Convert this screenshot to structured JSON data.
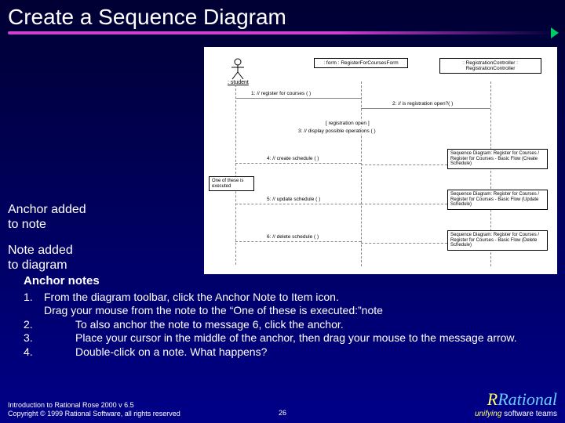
{
  "title": "Create a  Sequence Diagram",
  "annotations": {
    "anchor_added": "Anchor added\nto note",
    "note_added": "Note added\nto diagram"
  },
  "diagram": {
    "actor_label": ": student",
    "lifeline_form": ": form : RegisterForCoursesForm",
    "lifeline_controller": ": RegistrationController : RegistrationController",
    "msg1": "1: // register for courses ( )",
    "msg2": "2: // is registration open?( )",
    "guard": "[ registration open ]",
    "msg3": "3: // display possible operations ( )",
    "msg4": "4: // create schedule ( )",
    "msg5": "5: // update schedule ( )",
    "msg6": "6: // delete schedule ( )",
    "note_one_exec": "One of these is executed",
    "note_ref_create": "Sequence Diagram: Register for Courses / Register for Courses - Basic Flow (Create Schedule)",
    "note_ref_update": "Sequence Diagram: Register for Courses / Register for Courses - Basic Flow (Update Schedule)",
    "note_ref_delete": "Sequence Diagram: Register for Courses / Register for Courses - Basic Flow (Delete Schedule)"
  },
  "body": {
    "heading": "Anchor notes",
    "steps": [
      {
        "num": "1.",
        "text": "From the diagram toolbar, click the Anchor Note to Item icon."
      },
      {
        "num": "",
        "text": "Drag your mouse from the note to the “One of these is executed:”note"
      },
      {
        "num": "2.",
        "text": "To also anchor the note to message 6, click the anchor."
      },
      {
        "num": "3.",
        "text": "Place your cursor in the middle of the anchor, then drag your mouse to the message arrow."
      },
      {
        "num": "4.",
        "text": "Double-click on a note. What happens?"
      }
    ]
  },
  "footer": {
    "line1": "Introduction to Rational Rose 2000 v 6.5",
    "line2": "Copyright © 1999 Rational Software, all rights reserved",
    "page": "26",
    "brand_name": "Rational",
    "brand_tag_pre": "unifying",
    "brand_tag_post": " software teams"
  }
}
